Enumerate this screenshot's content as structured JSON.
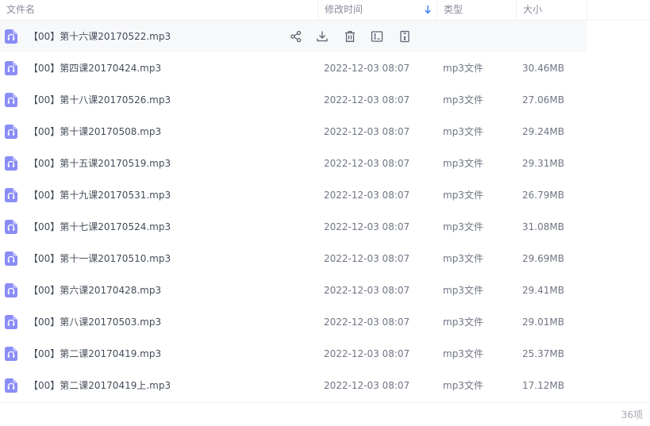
{
  "columns": {
    "name": "文件名",
    "modified": "修改时间",
    "type": "类型",
    "size": "大小"
  },
  "colors": {
    "audio_icon": "#8b8df7",
    "sort_arrow": "#3b7cf6",
    "action_icon": "#5b6170"
  },
  "row_actions": [
    "share-icon",
    "download-icon",
    "delete-icon",
    "rename-icon",
    "more-icon"
  ],
  "files": [
    {
      "name": "【00】第十六课20170522.mp3",
      "modified": "",
      "type": "",
      "size": "",
      "hover": true
    },
    {
      "name": "【00】第四课20170424.mp3",
      "modified": "2022-12-03 08:07",
      "type": "mp3文件",
      "size": "30.46MB"
    },
    {
      "name": "【00】第十八课20170526.mp3",
      "modified": "2022-12-03 08:07",
      "type": "mp3文件",
      "size": "27.06MB"
    },
    {
      "name": "【00】第十课20170508.mp3",
      "modified": "2022-12-03 08:07",
      "type": "mp3文件",
      "size": "29.24MB"
    },
    {
      "name": "【00】第十五课20170519.mp3",
      "modified": "2022-12-03 08:07",
      "type": "mp3文件",
      "size": "29.31MB"
    },
    {
      "name": "【00】第十九课20170531.mp3",
      "modified": "2022-12-03 08:07",
      "type": "mp3文件",
      "size": "26.79MB"
    },
    {
      "name": "【00】第十七课20170524.mp3",
      "modified": "2022-12-03 08:07",
      "type": "mp3文件",
      "size": "31.08MB"
    },
    {
      "name": "【00】第十一课20170510.mp3",
      "modified": "2022-12-03 08:07",
      "type": "mp3文件",
      "size": "29.69MB"
    },
    {
      "name": "【00】第六课20170428.mp3",
      "modified": "2022-12-03 08:07",
      "type": "mp3文件",
      "size": "29.41MB"
    },
    {
      "name": "【00】第八课20170503.mp3",
      "modified": "2022-12-03 08:07",
      "type": "mp3文件",
      "size": "29.01MB"
    },
    {
      "name": "【00】第二课20170419.mp3",
      "modified": "2022-12-03 08:07",
      "type": "mp3文件",
      "size": "25.37MB"
    },
    {
      "name": "【00】第二课20170419上.mp3",
      "modified": "2022-12-03 08:07",
      "type": "mp3文件",
      "size": "17.12MB"
    }
  ],
  "footer": {
    "count": "36项"
  }
}
